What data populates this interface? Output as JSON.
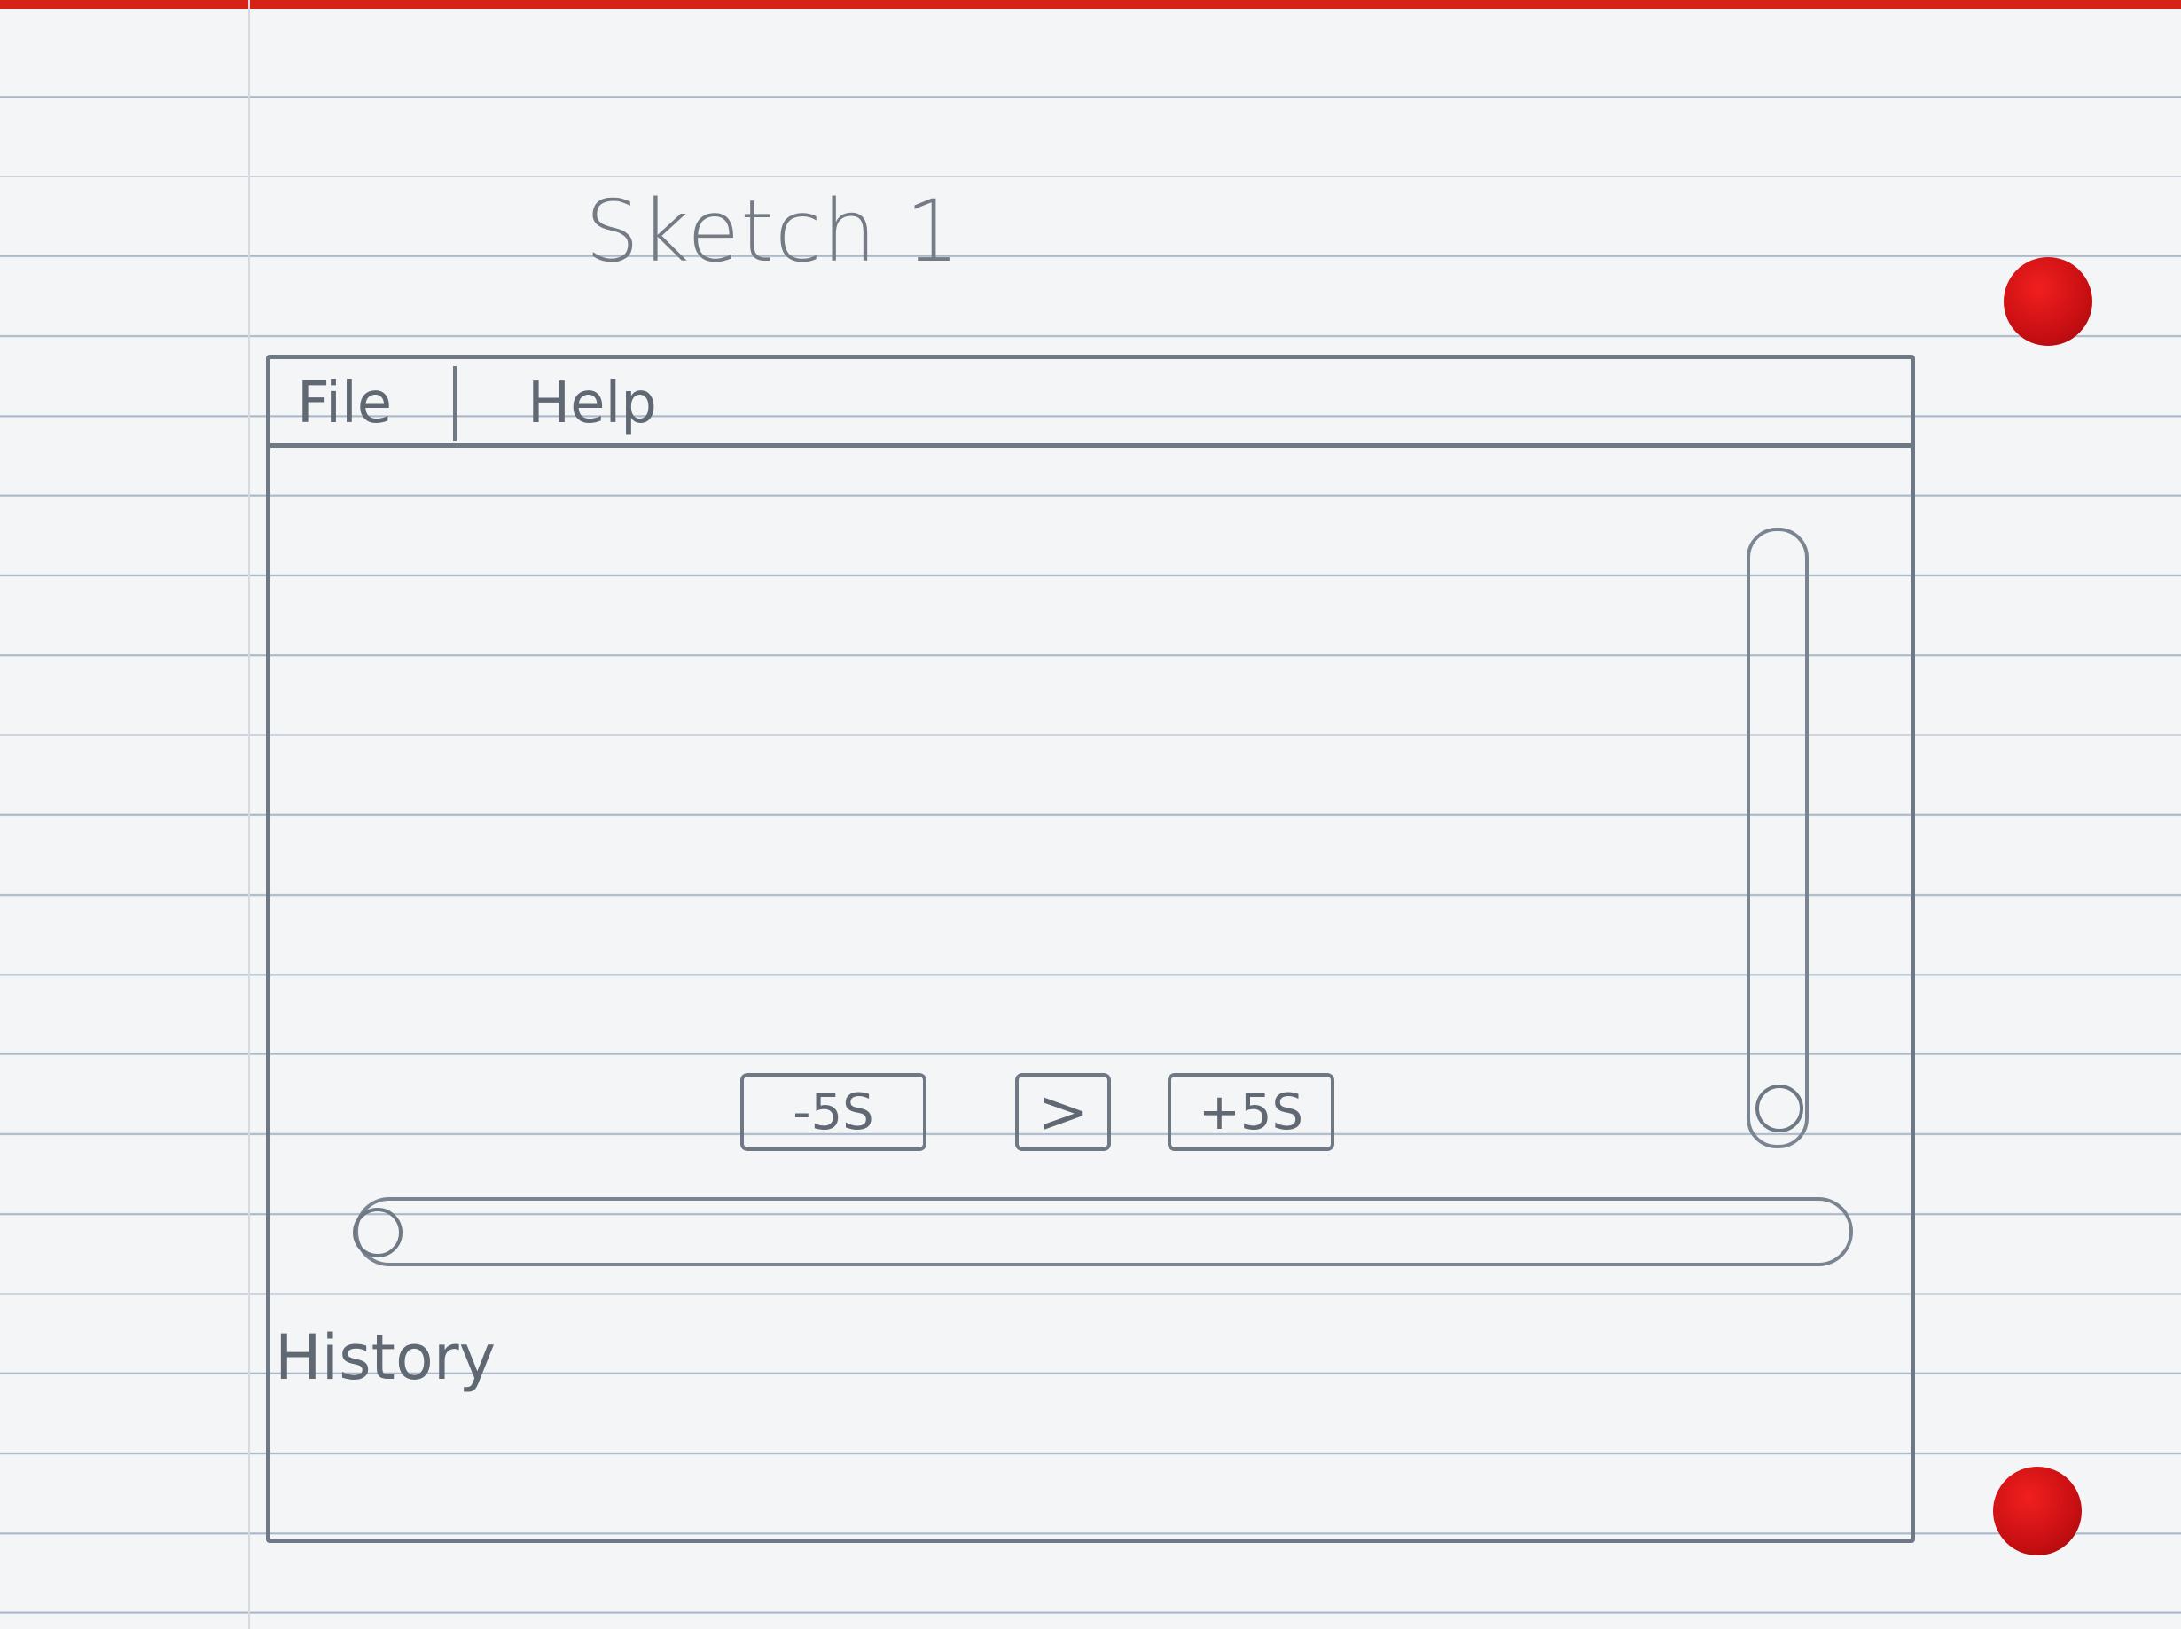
{
  "sheet": {
    "title": "Sketch 1"
  },
  "window": {
    "menu": {
      "file_label": "File",
      "help_label": "Help"
    },
    "controls": {
      "rewind_label": "-5S",
      "play_label": ">",
      "forward_label": "+5S"
    },
    "seek": {
      "progress": 0.0
    },
    "volume": {
      "level": 0.0
    },
    "history_label": "History"
  },
  "colors": {
    "pencil": "#6f7985",
    "hole": "#c80f12"
  }
}
